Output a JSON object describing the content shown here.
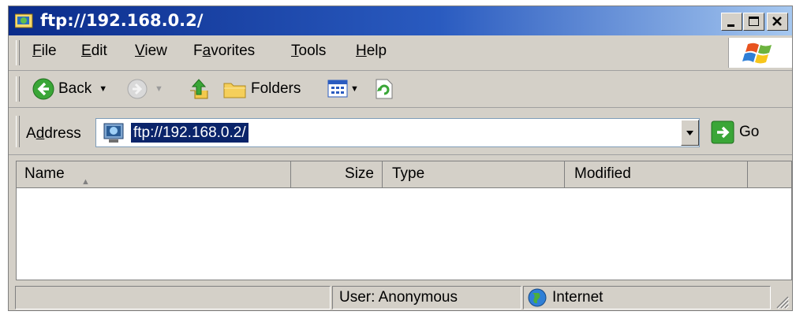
{
  "window": {
    "title": "ftp://192.168.0.2/",
    "controls": [
      "minimize-icon",
      "maximize-icon",
      "close-icon"
    ]
  },
  "menu": {
    "items": [
      {
        "label": "File",
        "mnemonic": "F"
      },
      {
        "label": "Edit",
        "mnemonic": "E"
      },
      {
        "label": "View",
        "mnemonic": "V"
      },
      {
        "label": "Favorites",
        "mnemonic": "a"
      },
      {
        "label": "Tools",
        "mnemonic": "T"
      },
      {
        "label": "Help",
        "mnemonic": "H"
      }
    ],
    "logo_icon": "windows-flag-icon"
  },
  "toolbar": {
    "back_label": "Back",
    "folders_label": "Folders",
    "icons": [
      "back-arrow-icon",
      "forward-arrow-icon",
      "up-folder-icon",
      "folders-icon",
      "views-icon",
      "refresh-icon"
    ]
  },
  "address": {
    "label": "Address",
    "mnemonic": "d",
    "value": "ftp://192.168.0.2/",
    "go_label": "Go"
  },
  "list": {
    "columns": [
      {
        "label": "Name",
        "sorted": "ascending"
      },
      {
        "label": "Size"
      },
      {
        "label": "Type"
      },
      {
        "label": "Modified"
      }
    ],
    "rows": []
  },
  "status": {
    "left": "",
    "user": "User: Anonymous",
    "zone": "Internet"
  },
  "colors": {
    "title_gradient_start": "#0a2b8a",
    "title_gradient_end": "#a6c8f0",
    "chrome": "#d4d0c8",
    "selection": "#0a246a"
  }
}
